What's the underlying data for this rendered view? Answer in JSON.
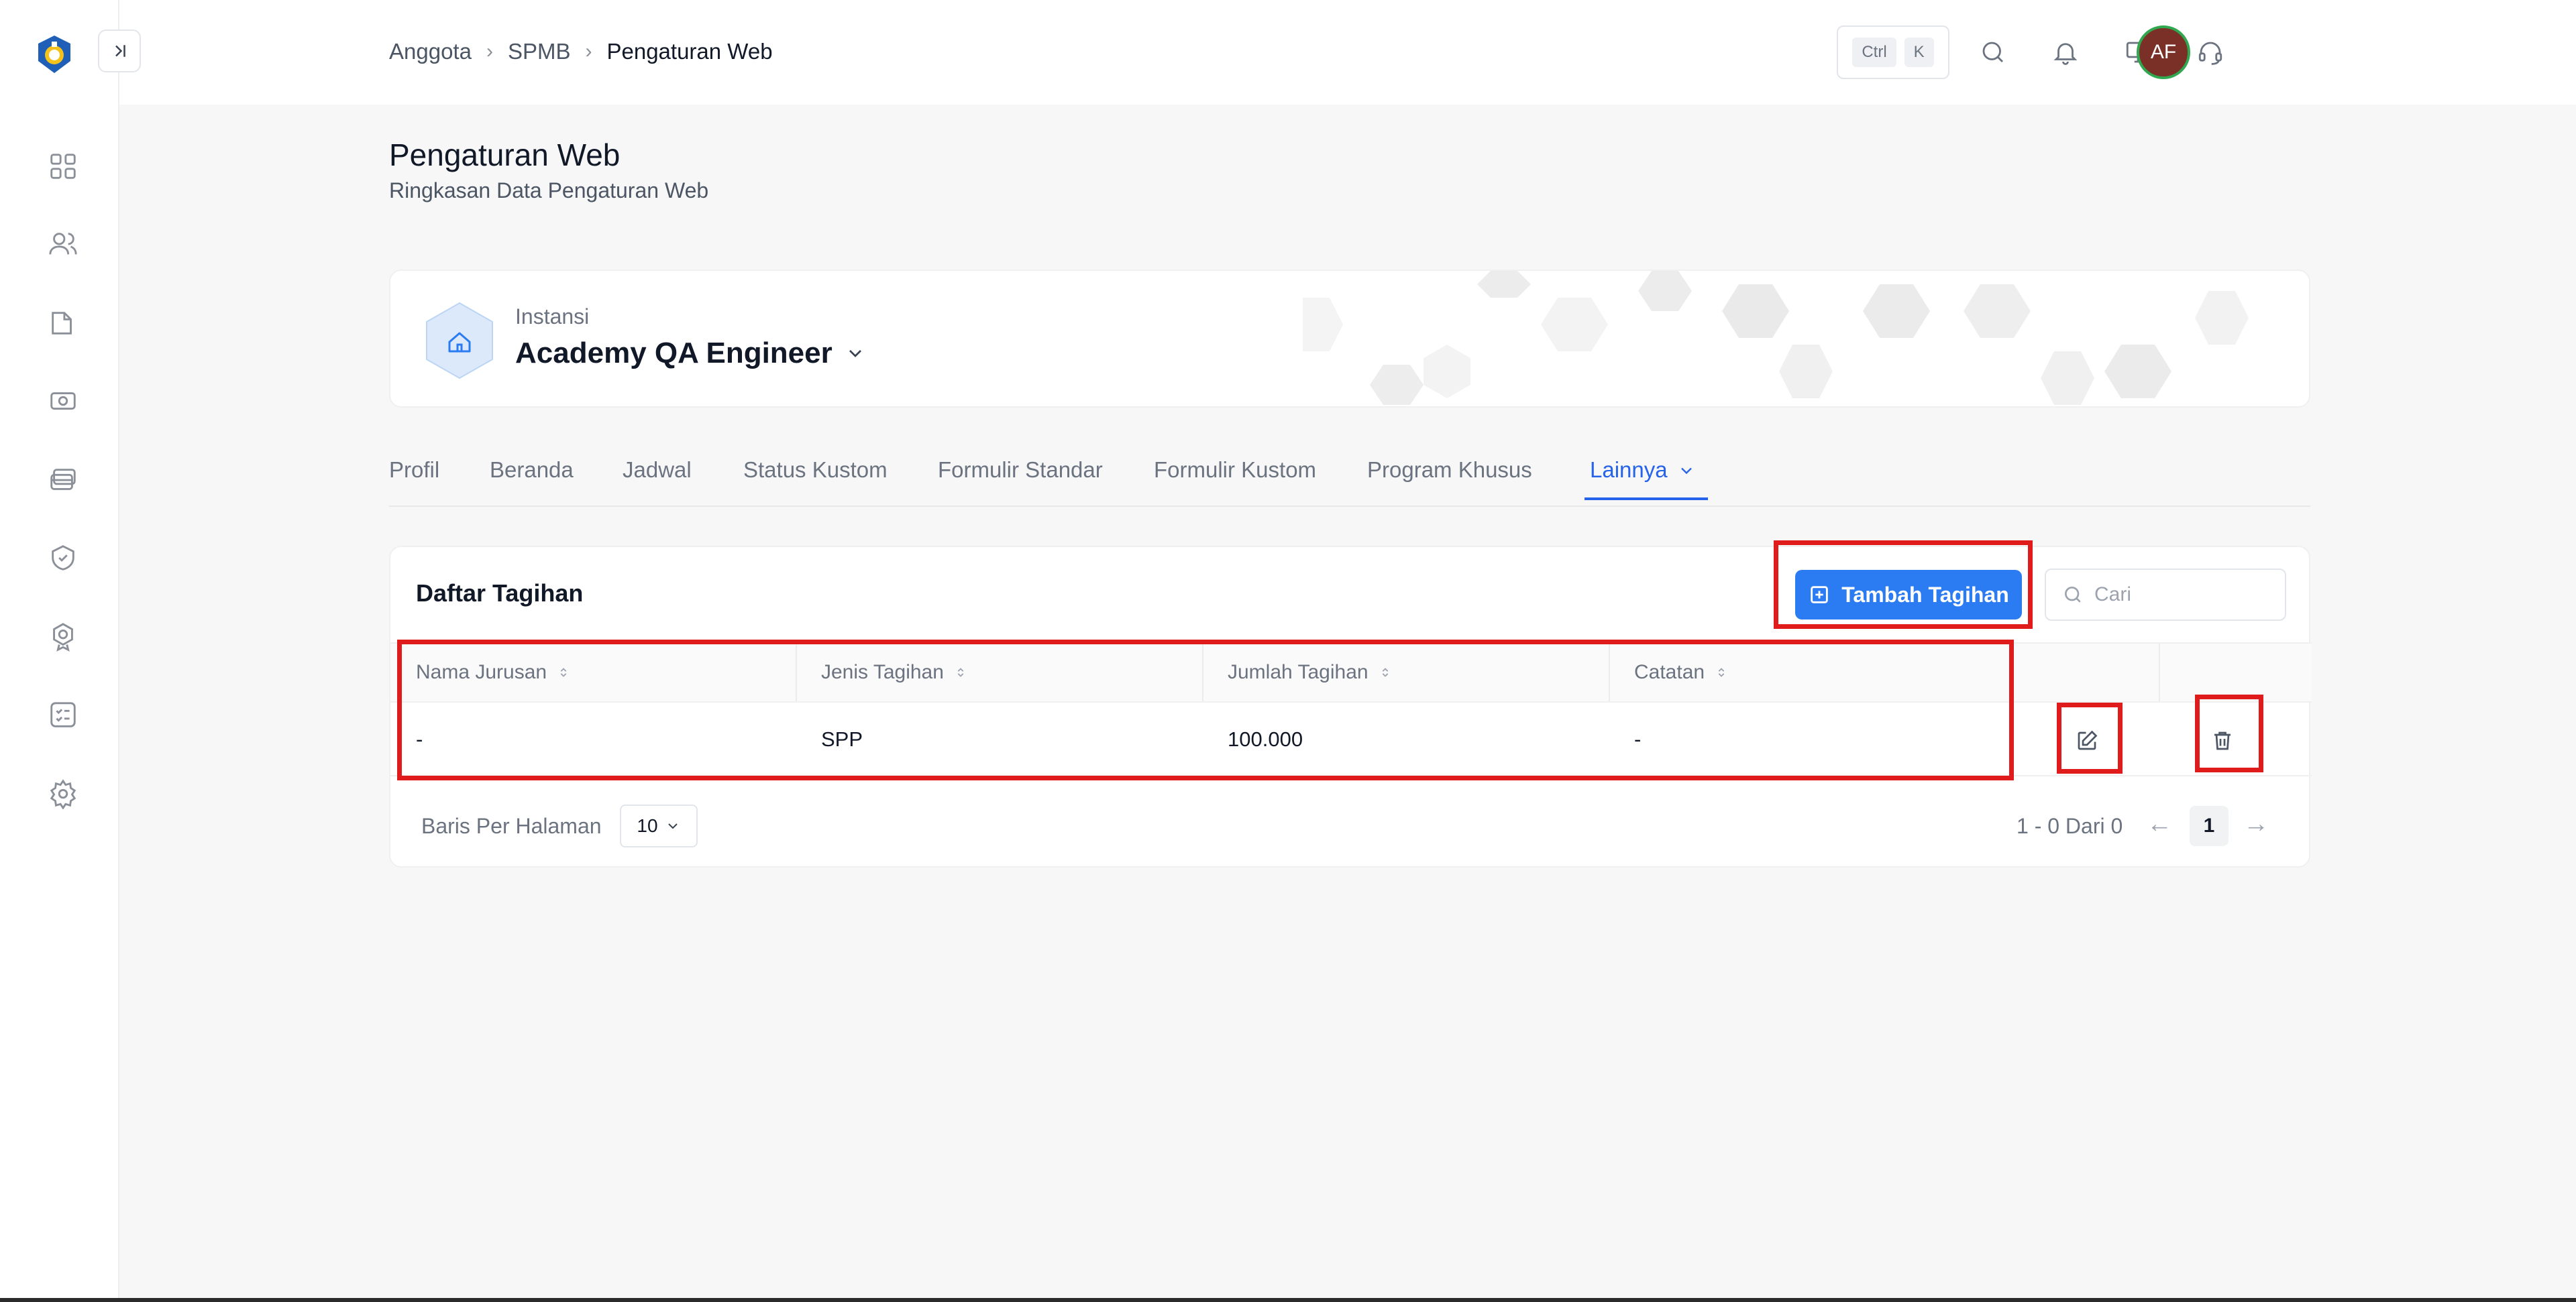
{
  "header": {
    "breadcrumb": [
      "Anggota",
      "SPMB",
      "Pengaturan Web"
    ],
    "kbd": [
      "Ctrl",
      "K"
    ],
    "avatar_initials": "AF"
  },
  "page": {
    "title": "Pengaturan Web",
    "subtitle": "Ringkasan Data Pengaturan Web"
  },
  "institution": {
    "label": "Instansi",
    "name": "Academy QA Engineer"
  },
  "tabs": [
    {
      "label": "Profil"
    },
    {
      "label": "Beranda"
    },
    {
      "label": "Jadwal"
    },
    {
      "label": "Status Kustom"
    },
    {
      "label": "Formulir Standar"
    },
    {
      "label": "Formulir Kustom"
    },
    {
      "label": "Program Khusus"
    },
    {
      "label": "Lainnya",
      "active": true
    }
  ],
  "bills": {
    "title": "Daftar Tagihan",
    "add_button": "Tambah Tagihan",
    "search_placeholder": "Cari",
    "columns": [
      "Nama Jurusan",
      "Jenis Tagihan",
      "Jumlah Tagihan",
      "Catatan"
    ],
    "rows": [
      {
        "nama_jurusan": "-",
        "jenis_tagihan": "SPP",
        "jumlah_tagihan": "100.000",
        "catatan": "-"
      }
    ],
    "rows_per_page_label": "Baris Per Halaman",
    "rows_per_page": "10",
    "range": "1 - 0 Dari 0",
    "current_page": "1"
  },
  "colors": {
    "accent": "#2b7bf3",
    "annotation": "#e01b1b",
    "avatar_bg": "#7a3027",
    "avatar_ring": "#2fa84f"
  }
}
